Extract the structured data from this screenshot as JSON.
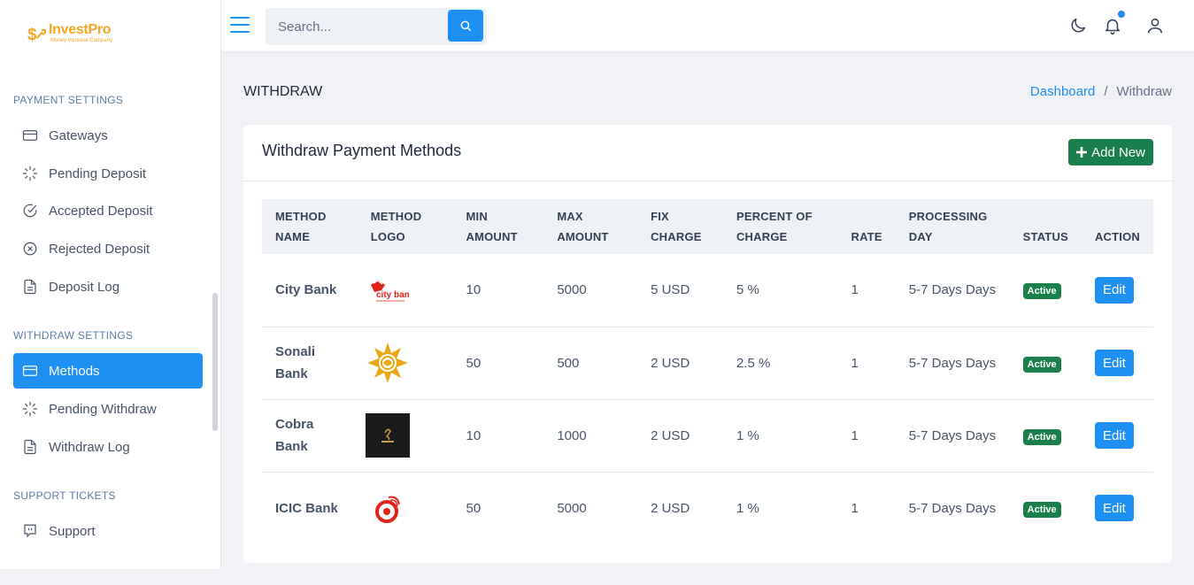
{
  "brand": {
    "name": "InvestPro",
    "tagline": "Money Increase Company"
  },
  "sidebar": {
    "payment_title": "PAYMENT SETTINGS",
    "payment_items": [
      {
        "label": "Gateways",
        "icon": "credit-card-icon"
      },
      {
        "label": "Pending Deposit",
        "icon": "spinner-icon"
      },
      {
        "label": "Accepted Deposit",
        "icon": "check-circle-icon"
      },
      {
        "label": "Rejected Deposit",
        "icon": "x-circle-icon"
      },
      {
        "label": "Deposit Log",
        "icon": "file-icon"
      }
    ],
    "withdraw_title": "WITHDRAW SETTINGS",
    "withdraw_items": [
      {
        "label": "Methods",
        "icon": "credit-card-icon",
        "active": true
      },
      {
        "label": "Pending Withdraw",
        "icon": "spinner-icon"
      },
      {
        "label": "Withdraw Log",
        "icon": "file-icon"
      }
    ],
    "support_title": "SUPPORT TICKETS",
    "support_items": [
      {
        "label": "Support",
        "icon": "chat-icon"
      }
    ]
  },
  "topbar": {
    "search_placeholder": "Search...",
    "icons": [
      "menu-icon",
      "search-icon",
      "moon-icon",
      "bell-icon",
      "user-icon"
    ]
  },
  "page": {
    "title": "WITHDRAW",
    "breadcrumb": {
      "home": "Dashboard",
      "separator": "/",
      "current": "Withdraw"
    }
  },
  "card": {
    "title": "Withdraw Payment Methods",
    "add_label": "Add New"
  },
  "table": {
    "headers": [
      [
        "METHOD",
        "NAME"
      ],
      [
        "METHOD",
        "LOGO"
      ],
      [
        "MIN",
        "AMOUNT"
      ],
      [
        "MAX",
        "AMOUNT"
      ],
      [
        "FIX",
        "CHARGE"
      ],
      [
        "PERCENT OF",
        "CHARGE"
      ],
      [
        "",
        "RATE"
      ],
      [
        "PROCESSING",
        "DAY"
      ],
      [
        "",
        "STATUS"
      ],
      [
        "",
        "ACTION"
      ]
    ],
    "rows": [
      {
        "name": "City Bank",
        "logo": "city-bank-logo",
        "min": "10",
        "max": "5000",
        "fix": "5 USD",
        "percent": "5 %",
        "rate": "1",
        "processing": "5-7 Days Days",
        "status": "Active",
        "action": "Edit"
      },
      {
        "name": "Sonali Bank",
        "logo": "sonali-bank-logo",
        "min": "50",
        "max": "500",
        "fix": "2 USD",
        "percent": "2.5 %",
        "rate": "1",
        "processing": "5-7 Days Days",
        "status": "Active",
        "action": "Edit"
      },
      {
        "name": "Cobra Bank",
        "logo": "cobra-bank-logo",
        "min": "10",
        "max": "1000",
        "fix": "2 USD",
        "percent": "1 %",
        "rate": "1",
        "processing": "5-7 Days Days",
        "status": "Active",
        "action": "Edit"
      },
      {
        "name": "ICIC Bank",
        "logo": "icic-bank-logo",
        "min": "50",
        "max": "5000",
        "fix": "2 USD",
        "percent": "1 %",
        "rate": "1",
        "processing": "5-7 Days Days",
        "status": "Active",
        "action": "Edit"
      }
    ]
  },
  "colors": {
    "accent": "#1e90f4",
    "success": "#1a7f4b",
    "brand": "#f5a623"
  }
}
